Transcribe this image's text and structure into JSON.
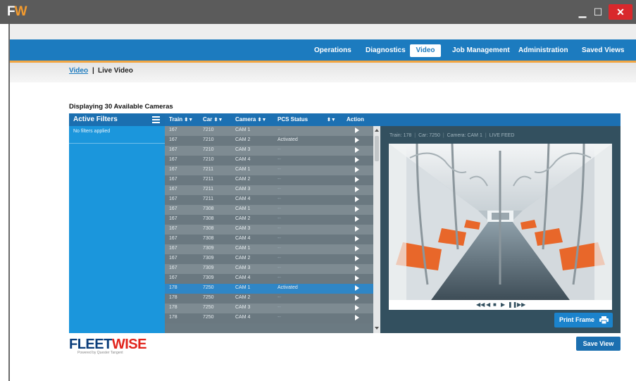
{
  "window": {
    "logo_f": "F",
    "logo_w": "W",
    "minimize": "▁",
    "maximize": "☐",
    "close": "✕"
  },
  "topnav": {
    "items": [
      {
        "label": "Operations"
      },
      {
        "label": "Diagnostics"
      },
      {
        "label": "Video",
        "active": true
      },
      {
        "label": "Job Management"
      },
      {
        "label": "Administration"
      },
      {
        "label": "Saved Views"
      }
    ]
  },
  "subnav": {
    "video": "Video",
    "separator": "|",
    "live": "Live Video"
  },
  "count_text": "Displaying 30 Available Cameras",
  "filters": {
    "title": "Active Filters",
    "note": "No filters applied"
  },
  "table": {
    "headers": [
      "Train",
      "Car",
      "Camera",
      "PCS Status",
      "Action"
    ],
    "sort_icon": "⬍▼",
    "rows": [
      {
        "train": "167",
        "car": "7210",
        "camera": "CAM 1",
        "status": "--"
      },
      {
        "train": "167",
        "car": "7210",
        "camera": "CAM 2",
        "status": "Activated"
      },
      {
        "train": "167",
        "car": "7210",
        "camera": "CAM 3",
        "status": "--"
      },
      {
        "train": "167",
        "car": "7210",
        "camera": "CAM 4",
        "status": "--"
      },
      {
        "train": "167",
        "car": "7211",
        "camera": "CAM 1",
        "status": "--"
      },
      {
        "train": "167",
        "car": "7211",
        "camera": "CAM 2",
        "status": "--"
      },
      {
        "train": "167",
        "car": "7211",
        "camera": "CAM 3",
        "status": "--"
      },
      {
        "train": "167",
        "car": "7211",
        "camera": "CAM 4",
        "status": "--"
      },
      {
        "train": "167",
        "car": "7308",
        "camera": "CAM 1",
        "status": "--"
      },
      {
        "train": "167",
        "car": "7308",
        "camera": "CAM 2",
        "status": "--"
      },
      {
        "train": "167",
        "car": "7308",
        "camera": "CAM 3",
        "status": "--"
      },
      {
        "train": "167",
        "car": "7308",
        "camera": "CAM 4",
        "status": "--"
      },
      {
        "train": "167",
        "car": "7309",
        "camera": "CAM 1",
        "status": "--"
      },
      {
        "train": "167",
        "car": "7309",
        "camera": "CAM 2",
        "status": "--"
      },
      {
        "train": "167",
        "car": "7309",
        "camera": "CAM 3",
        "status": "--"
      },
      {
        "train": "167",
        "car": "7309",
        "camera": "CAM 4",
        "status": "--"
      },
      {
        "train": "178",
        "car": "7250",
        "camera": "CAM 1",
        "status": "Activated",
        "selected": true
      },
      {
        "train": "178",
        "car": "7250",
        "camera": "CAM 2",
        "status": "--"
      },
      {
        "train": "178",
        "car": "7250",
        "camera": "CAM 3",
        "status": "--"
      },
      {
        "train": "178",
        "car": "7250",
        "camera": "CAM 4",
        "status": "--"
      }
    ]
  },
  "feed": {
    "train": "Train: 178",
    "car": "Car: 7250",
    "camera": "Camera: CAM 1",
    "mode": "LIVE FEED",
    "separator": "|",
    "controls": [
      "◀◀",
      "◀",
      "■",
      "▶",
      "❚❚",
      "▶▶"
    ]
  },
  "print_label": "Print Frame",
  "save_label": "Save View",
  "brand": {
    "part1": "FLEET",
    "part2": "WISE",
    "tagline": "Powered by Quester Tangent"
  },
  "colors": {
    "accent": "#1c7bbf",
    "orange": "#f2a541",
    "panel": "#33505f",
    "selected_row": "#2f86c6"
  }
}
